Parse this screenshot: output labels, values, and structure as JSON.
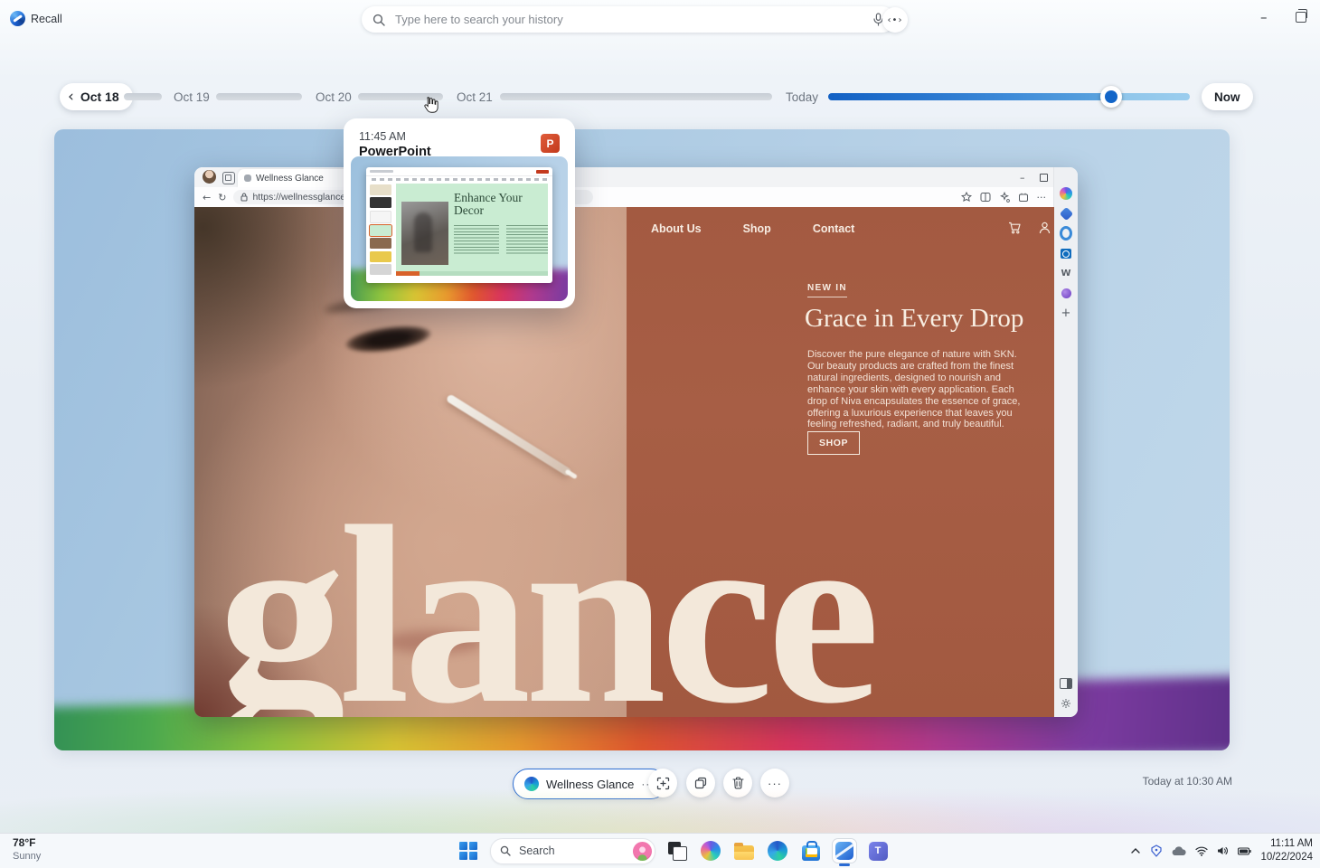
{
  "app": {
    "name": "Recall"
  },
  "header": {
    "search_placeholder": "Type here to search your history"
  },
  "icons": {
    "chevron_left": "‹",
    "scrubber": "‹•›",
    "minimize": "–",
    "close": "✕",
    "back": "←",
    "refresh": "↻",
    "more_h": "···",
    "plus": "+",
    "msn": "W",
    "powerpoint_initial": "P",
    "teams_initial": "T"
  },
  "timeline": {
    "selected": "Oct 18",
    "labels": [
      "Oct 19",
      "Oct 20",
      "Oct 21",
      "Today"
    ],
    "now": "Now"
  },
  "popup": {
    "time": "11:45 AM",
    "app": "PowerPoint",
    "slide_title": "Enhance Your Decor"
  },
  "browser": {
    "tab": "Wellness Glance",
    "url": "https://wellnessglance.com",
    "nav": [
      "About Us",
      "Shop",
      "Contact"
    ],
    "hero": {
      "eyebrow": "NEW IN",
      "title": "Grace in Every Drop",
      "body": "Discover the pure elegance of nature with SKN. Our beauty products are crafted from the finest natural ingredients, designed to nourish and enhance your skin with every application. Each drop of Niva encapsulates the essence of grace, offering a luxurious experience that leaves you feeling refreshed, radiant, and truly beautiful.",
      "cta": "SHOP",
      "watermark": "glance"
    }
  },
  "actionbar": {
    "snapshot": "Wellness Glance",
    "timestamp": "Today at 10:30 AM"
  },
  "taskbar": {
    "weather": {
      "temp": "78°F",
      "condition": "Sunny"
    },
    "search_placeholder": "Search",
    "clock": {
      "time": "11:11 AM",
      "date": "10/22/2024"
    }
  },
  "colors": {
    "accent_blue": "#1566c8",
    "terracotta": "#a65c43",
    "cream": "#f2e7da",
    "slide_mint": "#c9ecd2"
  }
}
